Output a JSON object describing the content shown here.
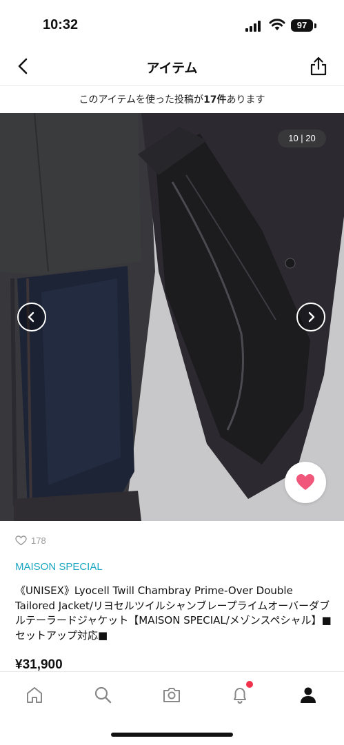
{
  "status_bar": {
    "time": "10:32",
    "battery": "97"
  },
  "nav": {
    "title": "アイテム"
  },
  "notice": {
    "prefix": "このアイテムを使った投稿が",
    "count": "17件",
    "suffix": "あります"
  },
  "gallery": {
    "counter": "10 | 20"
  },
  "item": {
    "likes": "178",
    "brand": "MAISON SPECIAL",
    "name": "《UNISEX》Lyocell Twill Chambray Prime-Over Double Tailored Jacket/リヨセルツイルシャンブレープライムオーバーダブルテーラードジャケット【MAISON SPECIAL/メゾンスペシャル】■セットアップ対応■",
    "price": "¥31,900"
  },
  "tabbar": {
    "items": [
      {
        "icon": "home-icon"
      },
      {
        "icon": "search-icon"
      },
      {
        "icon": "camera-icon"
      },
      {
        "icon": "bell-icon"
      },
      {
        "icon": "user-icon"
      }
    ]
  },
  "colors": {
    "brand": "#1aa7c2",
    "favorite": "#f0577a",
    "notification": "#f0314c"
  }
}
